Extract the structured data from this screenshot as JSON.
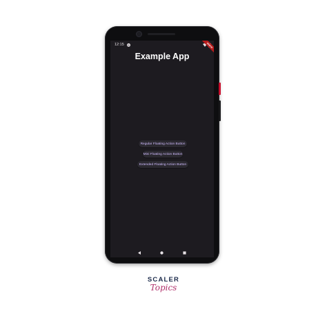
{
  "status_bar": {
    "time": "12:15",
    "notification_glyph": "G",
    "icons": [
      "wifi-icon",
      "battery-icon"
    ]
  },
  "debug_banner": {
    "label": "DEBUG"
  },
  "app": {
    "title": "Example App"
  },
  "buttons": {
    "regular": "Regular Floating Action Button",
    "mini": "Mini Floating Action Button",
    "extended": "Extended Floating Action Button"
  },
  "nav_bar": {
    "icons": [
      "back-icon",
      "home-icon",
      "recents-icon"
    ]
  },
  "brand": {
    "line1": "SCALER",
    "line2": "Topics"
  },
  "colors": {
    "screen_bg": "#1d1b20",
    "button_bg": "#2b2930",
    "button_text": "#d0bcff",
    "debug_banner": "#b71c1c",
    "brand_dark": "#1b2a4a",
    "brand_accent": "#b0306b"
  }
}
